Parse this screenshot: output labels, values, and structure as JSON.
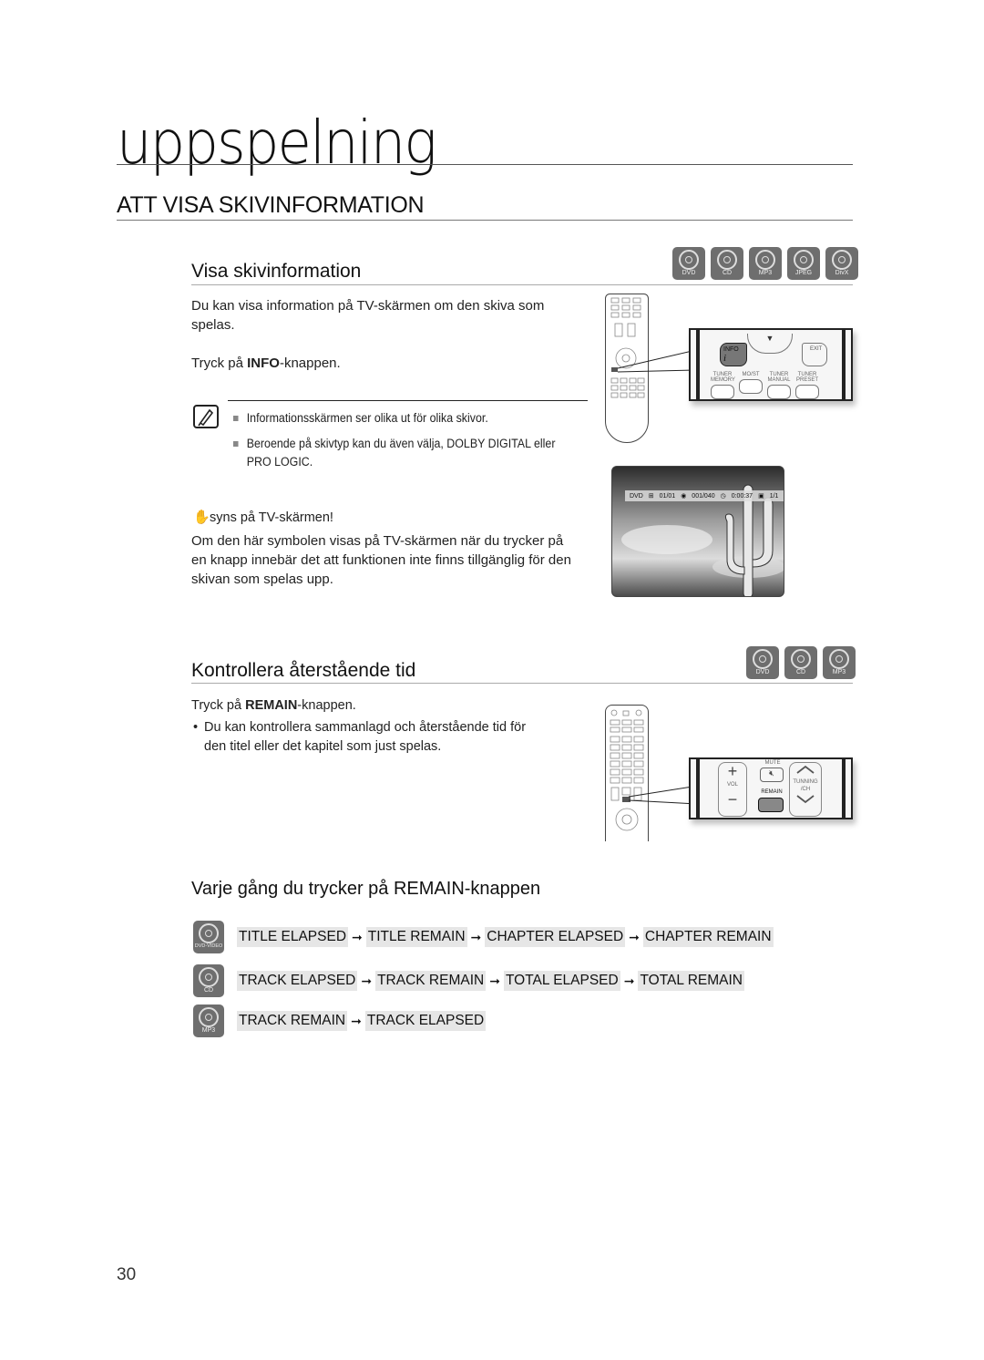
{
  "chapter": {
    "title": "uppspelning"
  },
  "section": {
    "title": "ATT VISA SKIVINFORMATION"
  },
  "visa": {
    "title": "Visa skivinformation",
    "disc_types": [
      "DVD",
      "CD",
      "MP3",
      "JPEG",
      "DivX"
    ],
    "intro_line1": "Du kan visa information på TV-skärmen om den skiva som",
    "intro_line2": "spelas.",
    "press_prefix": "Tryck på ",
    "press_button": "INFO",
    "press_suffix": "-knappen.",
    "notes": [
      "Informationsskärmen ser olika ut för olika skivor.",
      "Beroende på skivtyp kan du även välja, DOLBY DIGITAL eller",
      "PRO LOGIC."
    ],
    "hand_title": "syns på TV-skärmen!",
    "hand_text": [
      "Om den här symbolen visas på TV-skärmen när du trycker på",
      "en knapp innebär det att funktionen inte finns tillgänglig för den",
      "skivan som spelas upp."
    ],
    "remote_zoom": {
      "info_label": "INFO",
      "info_glyph": "i",
      "exit_label": "EXIT",
      "buttons": [
        "TUNER MEMORY",
        "MO/ST",
        "TUNER MANUAL",
        "TUNER PRESET"
      ]
    },
    "osd": {
      "disc": "DVD",
      "title": "01/01",
      "chapter": "001/040",
      "time": "0:00:37",
      "angle": "1/1",
      "play": "▶"
    }
  },
  "remain": {
    "title": "Kontrollera återstående tid",
    "disc_types": [
      "DVD",
      "CD",
      "MP3"
    ],
    "press_prefix": "Tryck på ",
    "press_button": "REMAIN",
    "press_suffix": "-knappen.",
    "bullet_line1": "Du kan kontrollera sammanlagd och återstående tid för",
    "bullet_line2": "den titel eller det kapitel som just spelas.",
    "remote_zoom": {
      "mute": "MUTE",
      "vol": "VOL",
      "remain": "REMAIN",
      "tuning": "TUNNING",
      "ch": "/CH",
      "plus": "+",
      "minus": "−"
    }
  },
  "cycle": {
    "title": "Varje gång du trycker på REMAIN-knappen",
    "arrow": "➞",
    "rows": [
      {
        "disc": "DVD-VIDEO",
        "steps": [
          "TITLE ELAPSED",
          "TITLE REMAIN",
          "CHAPTER ELAPSED",
          "CHAPTER REMAIN"
        ]
      },
      {
        "disc": "CD",
        "steps": [
          "TRACK ELAPSED",
          "TRACK REMAIN",
          "TOTAL ELAPSED",
          "TOTAL REMAIN"
        ]
      },
      {
        "disc": "MP3",
        "steps": [
          "TRACK REMAIN",
          "TRACK ELAPSED"
        ]
      }
    ]
  },
  "page_number": "30"
}
